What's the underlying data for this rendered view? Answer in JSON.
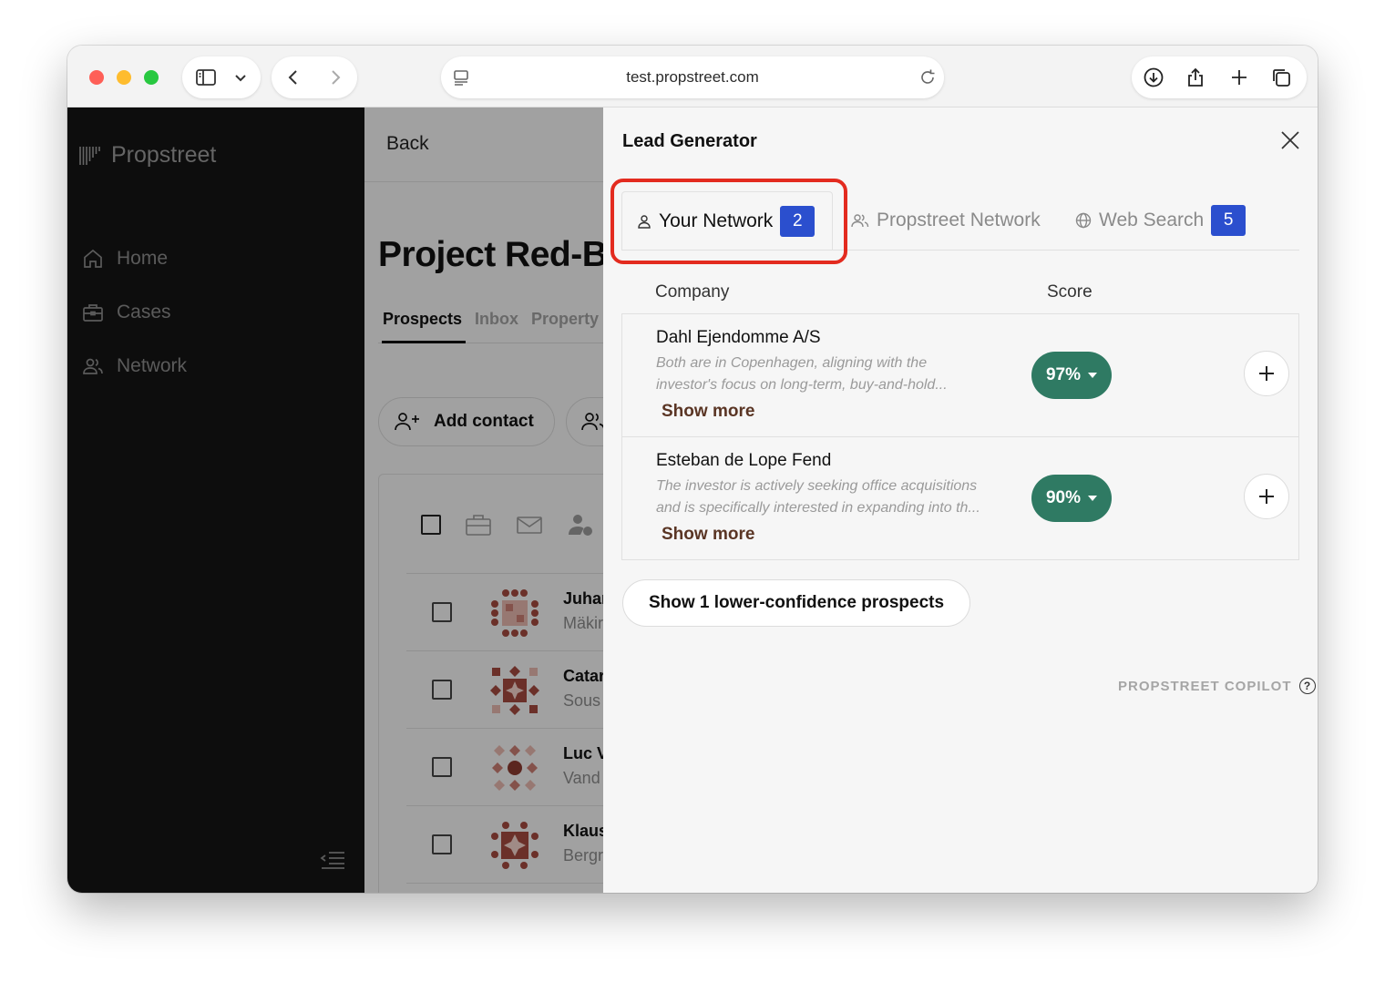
{
  "browser": {
    "url": "test.propstreet.com"
  },
  "sidebar": {
    "brand": "Propstreet",
    "items": [
      {
        "label": "Home",
        "icon": "home-icon"
      },
      {
        "label": "Cases",
        "icon": "briefcase-icon"
      },
      {
        "label": "Network",
        "icon": "people-icon"
      }
    ]
  },
  "main": {
    "back_label": "Back",
    "project_title": "Project Red-B",
    "tabs": [
      {
        "label": "Prospects"
      },
      {
        "label": "Inbox"
      },
      {
        "label": "Property"
      }
    ],
    "add_contact_label": "Add contact",
    "rows": [
      {
        "name": "Juhar",
        "sub": "Mäkir"
      },
      {
        "name": "Catar",
        "sub": "Sous"
      },
      {
        "name": "Luc V",
        "sub": "Vand"
      },
      {
        "name": "Klaus",
        "sub": "Bergr"
      }
    ]
  },
  "drawer": {
    "title": "Lead Generator",
    "tabs": [
      {
        "label": "Your Network",
        "count": "2",
        "icon": "person-icon"
      },
      {
        "label": "Propstreet Network",
        "icon": "people-icon"
      },
      {
        "label": "Web Search",
        "count": "5",
        "icon": "globe-icon"
      }
    ],
    "columns": {
      "company": "Company",
      "score": "Score"
    },
    "leads": [
      {
        "name": "Dahl Ejendomme A/S",
        "desc_line1": "Both are in Copenhagen, aligning with the",
        "desc_line2": "investor's focus on long-term, buy-and-hold...",
        "show_more": "Show more",
        "score": "97%"
      },
      {
        "name": "Esteban de Lope Fend",
        "desc_line1": "The investor is actively seeking office acquisitions",
        "desc_line2": "and is specifically interested in expanding into th...",
        "show_more": "Show more",
        "score": "90%"
      }
    ],
    "lower_confidence_label": "Show 1 lower-confidence prospects",
    "footer_label": "PROPSTREET COPILOT",
    "help_glyph": "?"
  },
  "colors": {
    "accent_badge": "#2b4fce",
    "score_green": "#2f7a63",
    "highlight_red": "#e32b1f",
    "sidebar_bg": "#141414"
  }
}
